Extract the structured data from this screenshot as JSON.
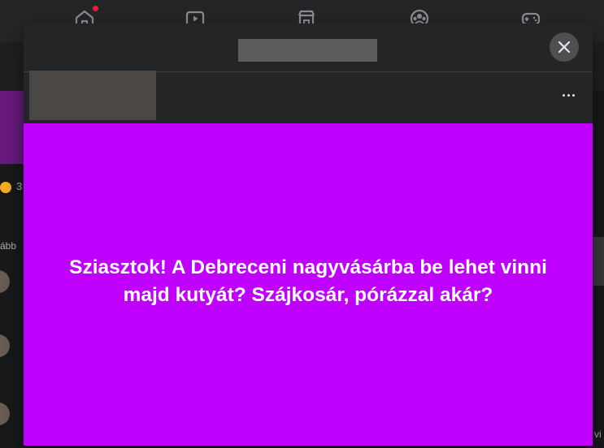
{
  "colors": {
    "post_background": "#c000ff",
    "post_text": "#ffffff",
    "modal_background": "#242526",
    "close_button_background": "#4e4f50",
    "notification_dot": "#e41e3f"
  },
  "top_nav": {
    "icons": [
      "home-icon",
      "video-icon",
      "marketplace-icon",
      "groups-icon",
      "gaming-icon"
    ]
  },
  "background": {
    "left_count": "3",
    "left_text": "ább",
    "right_text": "vi"
  },
  "modal": {
    "title": "",
    "author": "",
    "post_text": "Sziasztok! A Debreceni nagyvásárba be lehet vinni majd kutyát? Szájkosár, pórázzal akár?"
  }
}
